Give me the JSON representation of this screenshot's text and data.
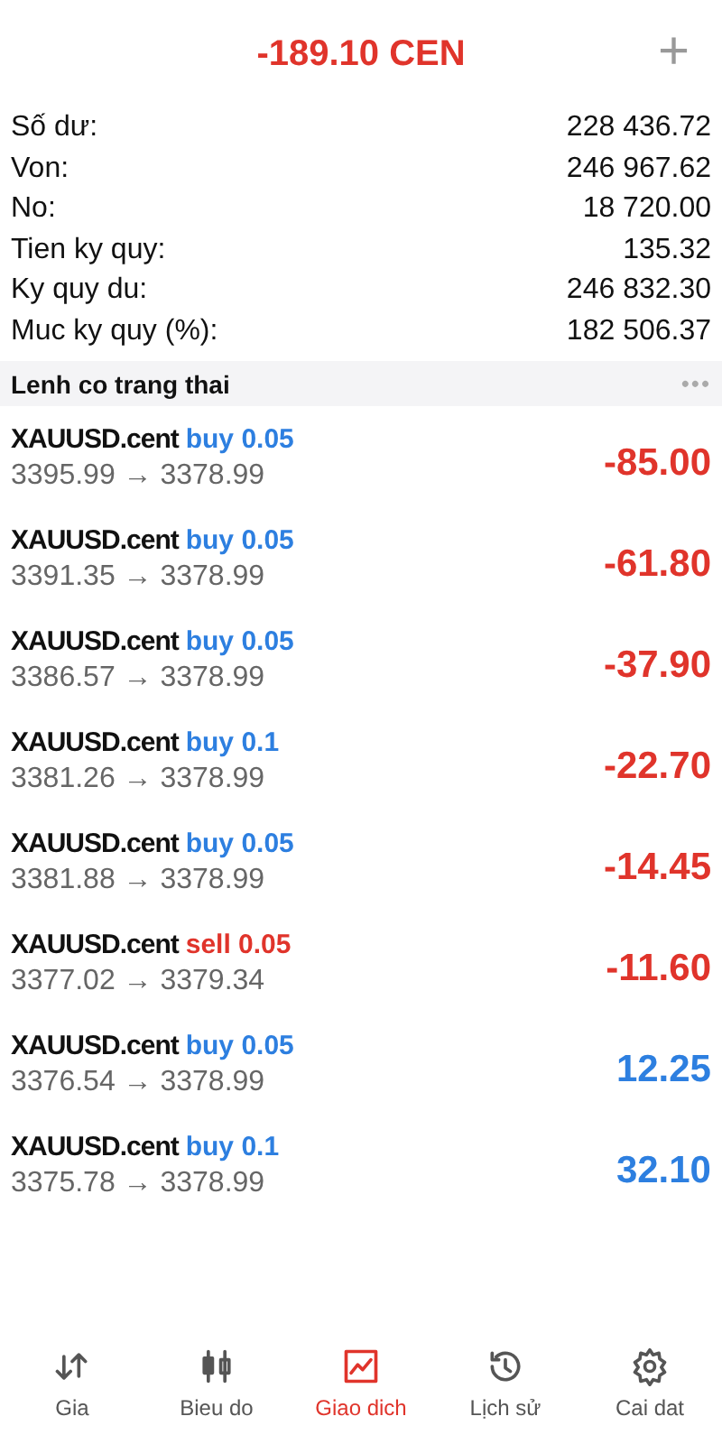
{
  "header": {
    "title": "-189.10 CEN",
    "kind": "loss",
    "action": "+"
  },
  "account": [
    {
      "label": "Số dư:",
      "value": "228 436.72"
    },
    {
      "label": "Von:",
      "value": "246 967.62"
    },
    {
      "label": "No:",
      "value": "18 720.00"
    },
    {
      "label": "Tien ky quy:",
      "value": "135.32"
    },
    {
      "label": "Ky quy du:",
      "value": "246 832.30"
    },
    {
      "label": "Muc ky quy (%):",
      "value": "182 506.37"
    }
  ],
  "section": {
    "title": "Lenh co trang thai",
    "menu": "•••"
  },
  "orders": [
    {
      "symbol": "XAUUSD.cent",
      "trade": {
        "text": "buy 0.05",
        "kind": "buy"
      },
      "prices": "3395.99 → 3378.99",
      "profit": {
        "text": "-85.00",
        "kind": "loss"
      }
    },
    {
      "symbol": "XAUUSD.cent",
      "trade": {
        "text": "buy 0.05",
        "kind": "buy"
      },
      "prices": "3391.35 → 3378.99",
      "profit": {
        "text": "-61.80",
        "kind": "loss"
      }
    },
    {
      "symbol": "XAUUSD.cent",
      "trade": {
        "text": "buy 0.05",
        "kind": "buy"
      },
      "prices": "3386.57 → 3378.99",
      "profit": {
        "text": "-37.90",
        "kind": "loss"
      }
    },
    {
      "symbol": "XAUUSD.cent",
      "trade": {
        "text": "buy 0.1",
        "kind": "buy"
      },
      "prices": "3381.26 → 3378.99",
      "profit": {
        "text": "-22.70",
        "kind": "loss"
      }
    },
    {
      "symbol": "XAUUSD.cent",
      "trade": {
        "text": "buy 0.05",
        "kind": "buy"
      },
      "prices": "3381.88 → 3378.99",
      "profit": {
        "text": "-14.45",
        "kind": "loss"
      }
    },
    {
      "symbol": "XAUUSD.cent",
      "trade": {
        "text": "sell 0.05",
        "kind": "sell"
      },
      "prices": "3377.02 → 3379.34",
      "profit": {
        "text": "-11.60",
        "kind": "loss"
      }
    },
    {
      "symbol": "XAUUSD.cent",
      "trade": {
        "text": "buy 0.05",
        "kind": "buy"
      },
      "prices": "3376.54 → 3378.99",
      "profit": {
        "text": "12.25",
        "kind": "gain"
      }
    },
    {
      "symbol": "XAUUSD.cent",
      "trade": {
        "text": "buy 0.1",
        "kind": "buy"
      },
      "prices": "3375.78 → 3378.99",
      "profit": {
        "text": "32.10",
        "kind": "gain"
      }
    }
  ],
  "tabs": [
    {
      "label": "Gia",
      "kind": "arrows",
      "selected": false
    },
    {
      "label": "Bieu do",
      "kind": "candles",
      "selected": false
    },
    {
      "label": "Giao dich",
      "kind": "trade",
      "selected": true
    },
    {
      "label": "Lịch sử",
      "kind": "history",
      "selected": false
    },
    {
      "label": "Cai dat",
      "kind": "settings",
      "selected": false
    }
  ]
}
